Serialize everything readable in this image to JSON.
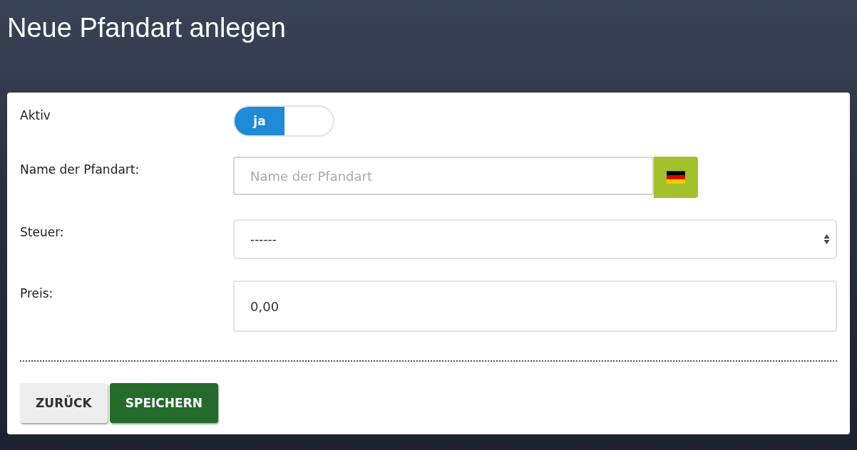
{
  "page_title": "Neue Pfandart anlegen",
  "fields": [
    {
      "kind": "toggle",
      "label": "Aktiv",
      "on": true,
      "on_label": "ja"
    },
    {
      "kind": "text",
      "label": "Name der Pfandart:",
      "placeholder": "Name der Pfandart"
    },
    {
      "kind": "select",
      "label": "Steuer:",
      "value": "------"
    },
    {
      "kind": "number",
      "label": "Preis:",
      "value": "0,00"
    }
  ],
  "buttons": [
    {
      "label": "ZURÜCK",
      "kind": "secondary"
    },
    {
      "label": "SPEICHERN",
      "kind": "primary"
    }
  ]
}
